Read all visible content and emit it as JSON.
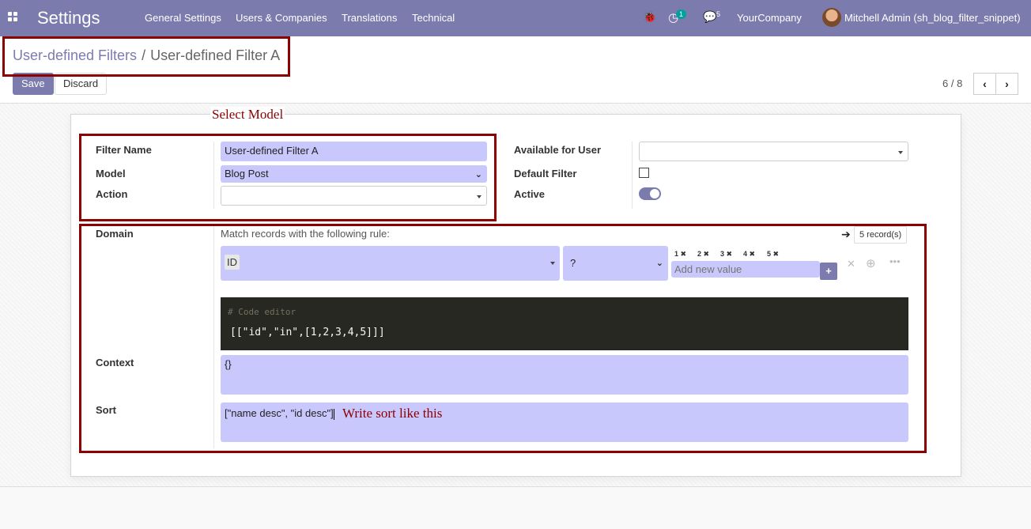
{
  "navbar": {
    "app_title": "Settings",
    "menu": [
      "General Settings",
      "Users & Companies",
      "Translations",
      "Technical"
    ],
    "activity_count": "1",
    "message_count": "5",
    "company": "YourCompany",
    "user": "Mitchell Admin (sh_blog_filter_snippet)"
  },
  "breadcrumb": {
    "parent": "User-defined Filters",
    "separator": "/",
    "current": "User-defined Filter A"
  },
  "toolbar": {
    "save_label": "Save",
    "discard_label": "Discard",
    "pager_text": "6 / 8"
  },
  "annotations": {
    "select_model": "Select Model",
    "write_sort": "Write sort like this"
  },
  "form": {
    "filter_name_label": "Filter Name",
    "filter_name_value": "User-defined Filter A",
    "model_label": "Model",
    "model_value": "Blog Post",
    "action_label": "Action",
    "action_value": "",
    "available_for_user_label": "Available for User",
    "available_for_user_value": "",
    "default_filter_label": "Default Filter",
    "default_filter_checked": false,
    "active_label": "Active",
    "active_on": true,
    "domain_label": "Domain",
    "domain_rule_text": "Match records with the following rule:",
    "records_button": "5 record(s)",
    "domain_field": "ID",
    "domain_operator": "?",
    "domain_values": [
      "1",
      "2",
      "3",
      "4",
      "5"
    ],
    "add_value_placeholder": "Add new value",
    "code_editor_comment": "# Code editor",
    "code_editor_content": "[[\"id\",\"in\",[1,2,3,4,5]]]",
    "context_label": "Context",
    "context_value": "{}",
    "sort_label": "Sort",
    "sort_value": "[\"name desc\", \"id desc\"]"
  },
  "colors": {
    "brand": "#7c7bad",
    "field_bg": "#c9c8fd",
    "annotation": "#8b0000",
    "code_bg": "#272822"
  }
}
